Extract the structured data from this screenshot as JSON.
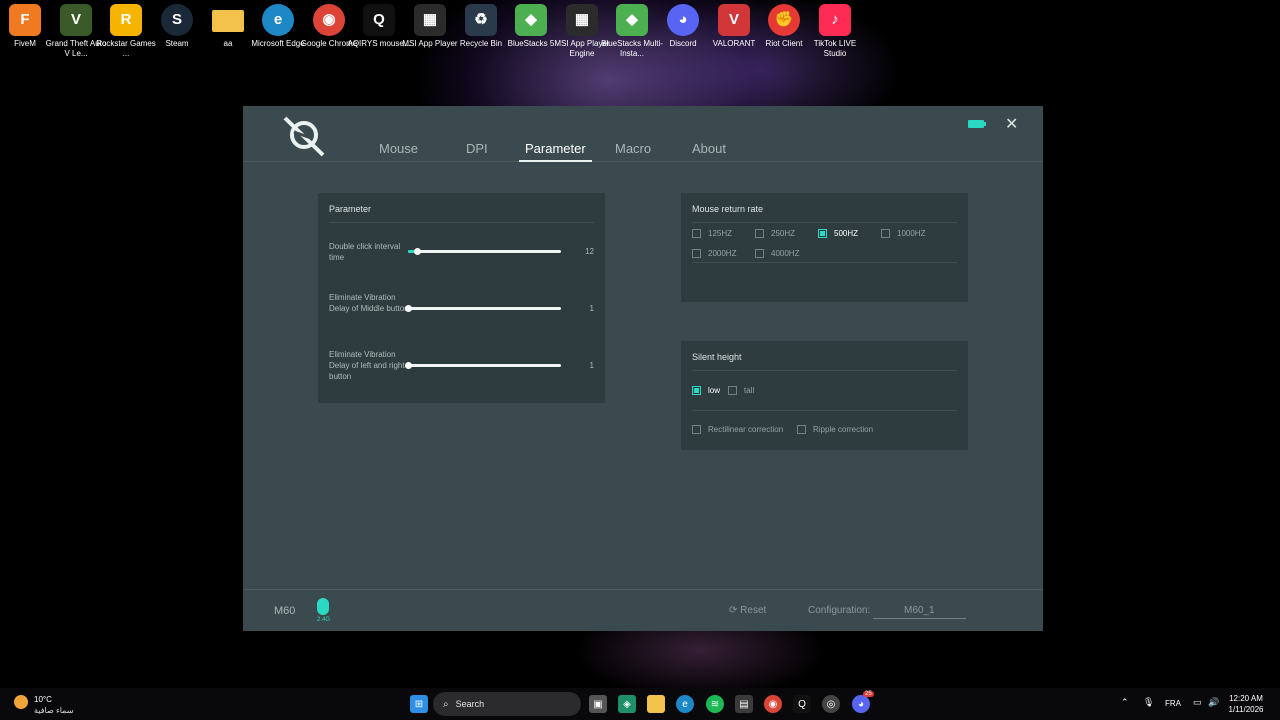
{
  "desktop": {
    "icons": [
      {
        "label": "FiveM",
        "color": "#f07a22",
        "glyph": "F"
      },
      {
        "label": "Grand Theft Auto V Le...",
        "color": "#3a5a2a",
        "glyph": "V"
      },
      {
        "label": "Rockstar Games ...",
        "color": "#f4b400",
        "glyph": "R"
      },
      {
        "label": "Steam",
        "color": "#1b2838",
        "glyph": "S"
      },
      {
        "label": "aa",
        "color": "#f2c24b",
        "glyph": ""
      },
      {
        "label": "Microsoft Edge",
        "color": "#1e88c7",
        "glyph": "e"
      },
      {
        "label": "Google Chrome",
        "color": "#db4437",
        "glyph": "◉"
      },
      {
        "label": "AQIRYS mouse...",
        "color": "#111111",
        "glyph": "Q"
      },
      {
        "label": "MSI App Player",
        "color": "#2b2b2b",
        "glyph": "▦"
      },
      {
        "label": "Recycle Bin",
        "color": "#2a3a4a",
        "glyph": "♻"
      },
      {
        "label": "BlueStacks 5",
        "color": "#4caf50",
        "glyph": "◆"
      },
      {
        "label": "MSI App Player Engine",
        "color": "#2b2b2b",
        "glyph": "▦"
      },
      {
        "label": "BlueStacks Multi-Insta...",
        "color": "#4caf50",
        "glyph": "◆"
      },
      {
        "label": "Discord",
        "color": "#5865f2",
        "glyph": "◕"
      },
      {
        "label": "VALORANT",
        "color": "#d13639",
        "glyph": "V"
      },
      {
        "label": "Riot Client",
        "color": "#e53935",
        "glyph": "✊"
      },
      {
        "label": "TikTok LIVE Studio",
        "color": "#fe2c55",
        "glyph": "♪"
      }
    ]
  },
  "app": {
    "tabs": [
      "Mouse",
      "DPI",
      "Parameter",
      "Macro",
      "About"
    ],
    "active_tab": "Parameter",
    "accent": "#29d9c2",
    "parameter_panel": {
      "title": "Parameter",
      "sliders": [
        {
          "label": "Double click interval time",
          "value": "12",
          "fraction": 0.06
        },
        {
          "label": "Eliminate Vibration Delay of Middle button",
          "value": "1",
          "fraction": 0.0
        },
        {
          "label": "Eliminate Vibration Delay of left and right button",
          "value": "1",
          "fraction": 0.0
        }
      ]
    },
    "return_rate_panel": {
      "title": "Mouse return rate",
      "options": [
        "125HZ",
        "250HZ",
        "500HZ",
        "1000HZ",
        "2000HZ",
        "4000HZ"
      ],
      "selected": "500HZ"
    },
    "silent_panel": {
      "title": "Silent height",
      "height_options": [
        "low",
        "tall"
      ],
      "selected_height": "low",
      "corrections": [
        "Rectilinear correction",
        "Ripple correction"
      ]
    },
    "footer": {
      "model": "M60",
      "connection": "2.4G",
      "reset_label": "Reset",
      "config_label": "Configuration:",
      "config_value": "M60_1"
    }
  },
  "taskbar": {
    "weather_temp": "10°C",
    "weather_condition": "سماء صافية",
    "search_placeholder": "Search",
    "language": "FRA",
    "time": "12:20 AM",
    "date": "1/11/2026",
    "discord_badge": "25"
  }
}
